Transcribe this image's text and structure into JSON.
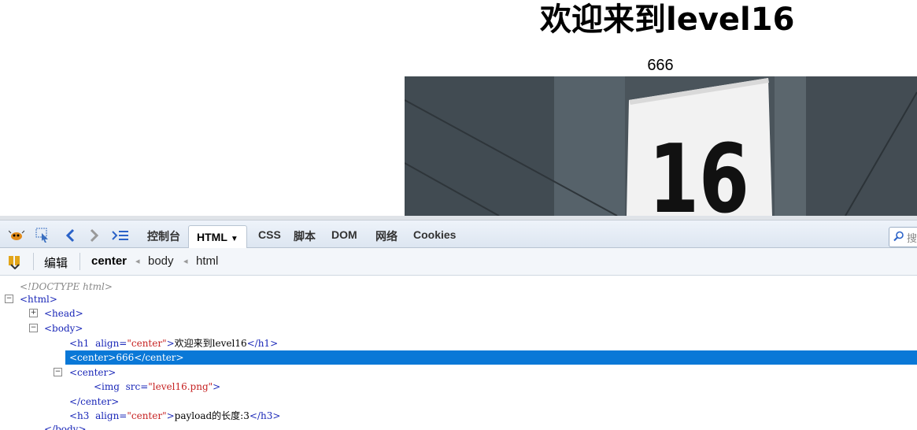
{
  "page": {
    "heading": "欢迎来到level16",
    "center_text": "666",
    "image_text": "16"
  },
  "devtools": {
    "tabs": [
      "控制台",
      "HTML",
      "CSS",
      "脚本",
      "DOM",
      "网络",
      "Cookies"
    ],
    "active_tab": "HTML",
    "edit_label": "编辑",
    "breadcrumbs": [
      "center",
      "body",
      "html"
    ],
    "search_placeholder": "搜"
  },
  "tree": {
    "doctype": "<!DOCTYPE html>",
    "html_open": "<html>",
    "head_open": "<head>",
    "body_open": "<body>",
    "h1_open": "<h1",
    "h1_attr": "align=",
    "h1_val": "\"center\"",
    "h1_close_bracket": ">",
    "h1_text": "欢迎来到level16",
    "h1_close": "</h1>",
    "center1_open": "<center>",
    "center1_text": "666",
    "center1_close": "</center>",
    "center2_open": "<center>",
    "img_open": "<img",
    "img_attr": "src=",
    "img_val": "\"level16.png\"",
    "img_close": ">",
    "center2_close": "</center>",
    "h3_open": "<h3",
    "h3_attr": "align=",
    "h3_val": "\"center\"",
    "h3_close_bracket": ">",
    "h3_text": "payload的长度:3",
    "h3_close": "</h3>",
    "body_close_partial": "</body>"
  }
}
